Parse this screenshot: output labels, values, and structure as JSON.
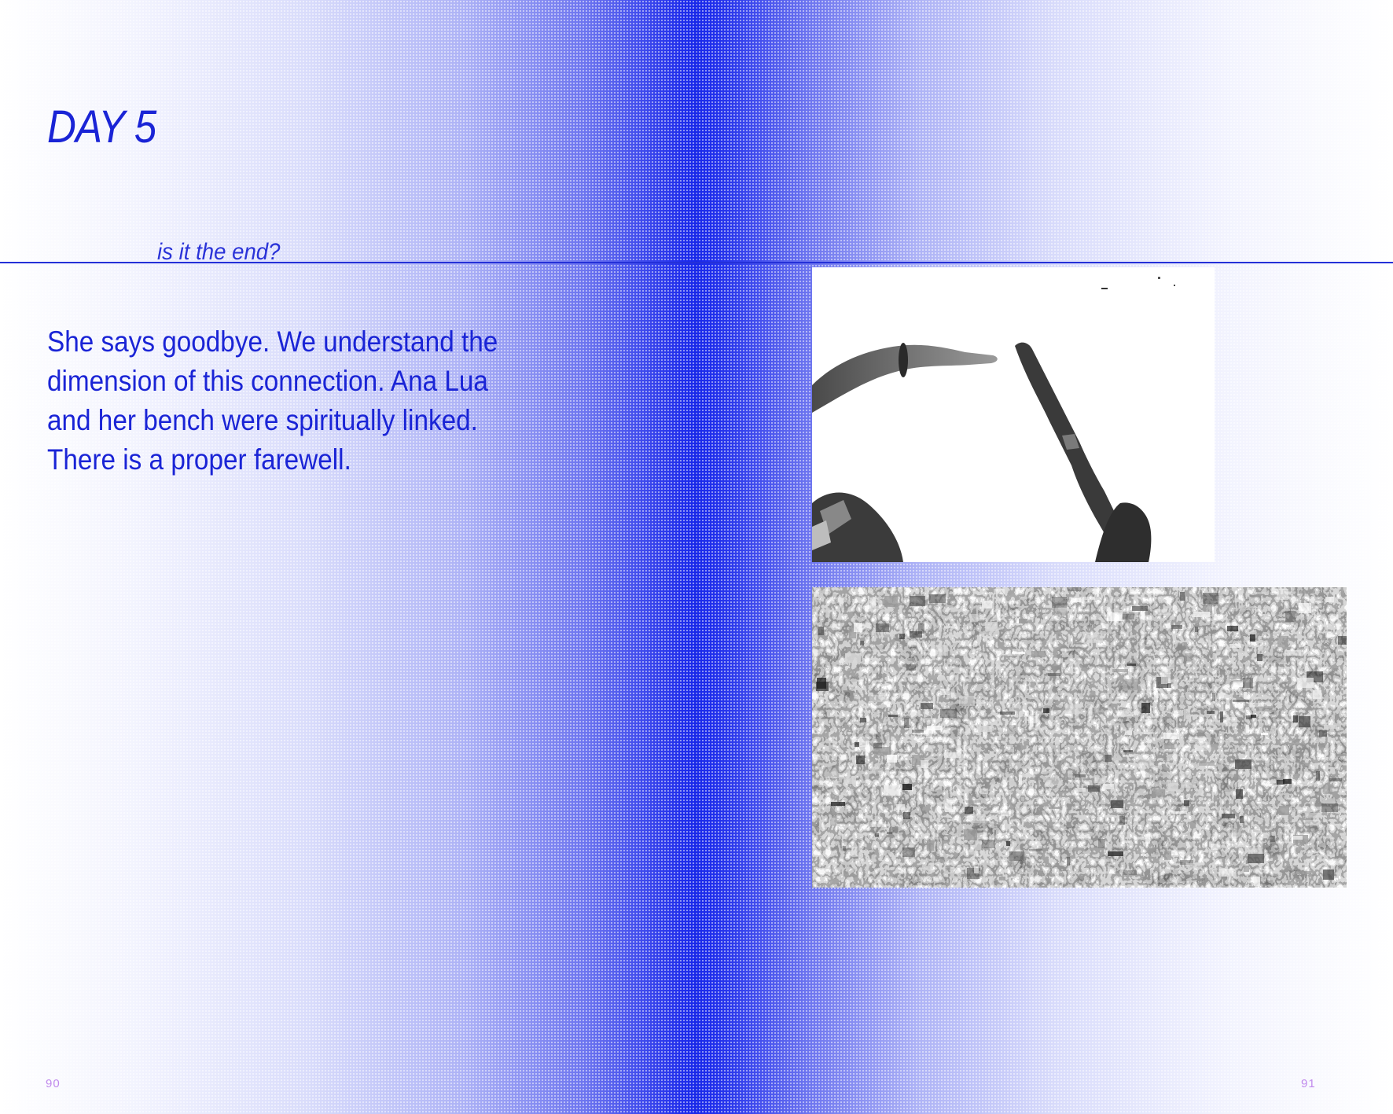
{
  "left_page": {
    "title": "DAY 5",
    "subtitle": "is it the end?",
    "paragraph_lines": [
      "She says goodbye. We understand the",
      "dimension of this connection. Ana Lua",
      "and her bench were spiritually linked.",
      "There is a proper farewell."
    ],
    "page_number": "90"
  },
  "right_page": {
    "page_number": "91"
  },
  "colors": {
    "accent_blue": "#1a24d6",
    "page_number": "#c089ec"
  }
}
